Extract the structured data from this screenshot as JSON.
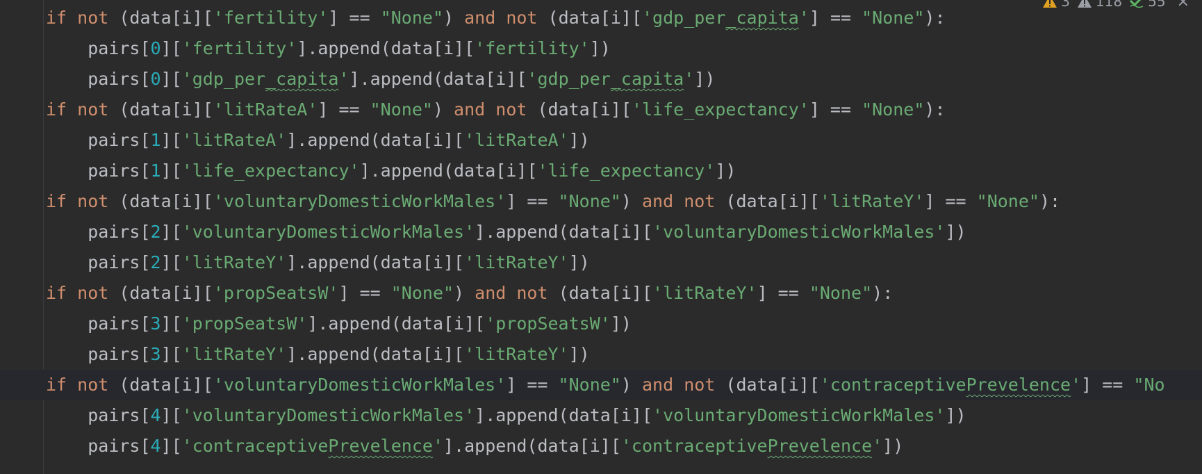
{
  "inspections": {
    "errors": "3",
    "warnings": "118",
    "weak_warnings": "55",
    "close_glyph": "×",
    "colors": {
      "error": "#e0a021",
      "warning": "#9aa0a6",
      "ok": "#5fb865"
    }
  },
  "intention_icon": "lightbulb-icon",
  "current_line_index": 12,
  "lines": [
    {
      "indent": 0,
      "tokens": [
        {
          "t": "if",
          "c": "kw"
        },
        {
          "t": " "
        },
        {
          "t": "not",
          "c": "kw"
        },
        {
          "t": " (data[i]["
        },
        {
          "t": "'fertility'",
          "c": "str"
        },
        {
          "t": "] == "
        },
        {
          "t": "\"None\"",
          "c": "str"
        },
        {
          "t": ") "
        },
        {
          "t": "and",
          "c": "kw"
        },
        {
          "t": " "
        },
        {
          "t": "not",
          "c": "kw"
        },
        {
          "t": " (data[i]["
        },
        {
          "t": "'gdp_per",
          "c": "str"
        },
        {
          "t": "_capita",
          "c": "str",
          "u": true
        },
        {
          "t": "'",
          "c": "str"
        },
        {
          "t": "] == "
        },
        {
          "t": "\"None\"",
          "c": "str"
        },
        {
          "t": "):"
        }
      ]
    },
    {
      "indent": 1,
      "tokens": [
        {
          "t": "pairs["
        },
        {
          "t": "0",
          "c": "num"
        },
        {
          "t": "]["
        },
        {
          "t": "'fertility'",
          "c": "str"
        },
        {
          "t": "].append(data[i]["
        },
        {
          "t": "'fertility'",
          "c": "str"
        },
        {
          "t": "])"
        }
      ]
    },
    {
      "indent": 1,
      "tokens": [
        {
          "t": "pairs["
        },
        {
          "t": "0",
          "c": "num"
        },
        {
          "t": "]["
        },
        {
          "t": "'gdp_per",
          "c": "str"
        },
        {
          "t": "_capita",
          "c": "str",
          "u": true
        },
        {
          "t": "'",
          "c": "str"
        },
        {
          "t": "].append(data[i]["
        },
        {
          "t": "'gdp_per",
          "c": "str"
        },
        {
          "t": "_capita",
          "c": "str",
          "u": true
        },
        {
          "t": "'",
          "c": "str"
        },
        {
          "t": "])"
        }
      ]
    },
    {
      "indent": 0,
      "tokens": [
        {
          "t": "if",
          "c": "kw"
        },
        {
          "t": " "
        },
        {
          "t": "not",
          "c": "kw"
        },
        {
          "t": " (data[i]["
        },
        {
          "t": "'litRateA'",
          "c": "str"
        },
        {
          "t": "] == "
        },
        {
          "t": "\"None\"",
          "c": "str"
        },
        {
          "t": ") "
        },
        {
          "t": "and",
          "c": "kw"
        },
        {
          "t": " "
        },
        {
          "t": "not",
          "c": "kw"
        },
        {
          "t": " (data[i]["
        },
        {
          "t": "'life_expectancy'",
          "c": "str"
        },
        {
          "t": "] == "
        },
        {
          "t": "\"None\"",
          "c": "str"
        },
        {
          "t": "):"
        }
      ]
    },
    {
      "indent": 1,
      "tokens": [
        {
          "t": "pairs["
        },
        {
          "t": "1",
          "c": "num"
        },
        {
          "t": "]["
        },
        {
          "t": "'litRateA'",
          "c": "str"
        },
        {
          "t": "].append(data[i]["
        },
        {
          "t": "'litRateA'",
          "c": "str"
        },
        {
          "t": "])"
        }
      ]
    },
    {
      "indent": 1,
      "tokens": [
        {
          "t": "pairs["
        },
        {
          "t": "1",
          "c": "num"
        },
        {
          "t": "]["
        },
        {
          "t": "'life_expectancy'",
          "c": "str"
        },
        {
          "t": "].append(data[i]["
        },
        {
          "t": "'life_expectancy'",
          "c": "str"
        },
        {
          "t": "])"
        }
      ]
    },
    {
      "indent": 0,
      "tokens": [
        {
          "t": "if",
          "c": "kw"
        },
        {
          "t": " "
        },
        {
          "t": "not",
          "c": "kw"
        },
        {
          "t": " (data[i]["
        },
        {
          "t": "'voluntaryDomesticWorkMales'",
          "c": "str"
        },
        {
          "t": "] == "
        },
        {
          "t": "\"None\"",
          "c": "str"
        },
        {
          "t": ") "
        },
        {
          "t": "and",
          "c": "kw"
        },
        {
          "t": " "
        },
        {
          "t": "not",
          "c": "kw"
        },
        {
          "t": " (data[i]["
        },
        {
          "t": "'litRateY'",
          "c": "str"
        },
        {
          "t": "] == "
        },
        {
          "t": "\"None\"",
          "c": "str"
        },
        {
          "t": "):"
        }
      ]
    },
    {
      "indent": 1,
      "tokens": [
        {
          "t": "pairs["
        },
        {
          "t": "2",
          "c": "num"
        },
        {
          "t": "]["
        },
        {
          "t": "'voluntaryDomesticWorkMales'",
          "c": "str"
        },
        {
          "t": "].append(data[i]["
        },
        {
          "t": "'voluntaryDomesticWorkMales'",
          "c": "str"
        },
        {
          "t": "])"
        }
      ]
    },
    {
      "indent": 1,
      "tokens": [
        {
          "t": "pairs["
        },
        {
          "t": "2",
          "c": "num"
        },
        {
          "t": "]["
        },
        {
          "t": "'litRateY'",
          "c": "str"
        },
        {
          "t": "].append(data[i]["
        },
        {
          "t": "'litRateY'",
          "c": "str"
        },
        {
          "t": "])"
        }
      ]
    },
    {
      "indent": 0,
      "tokens": [
        {
          "t": "if",
          "c": "kw"
        },
        {
          "t": " "
        },
        {
          "t": "not",
          "c": "kw"
        },
        {
          "t": " (data[i]["
        },
        {
          "t": "'propSeatsW'",
          "c": "str"
        },
        {
          "t": "] == "
        },
        {
          "t": "\"None\"",
          "c": "str"
        },
        {
          "t": ") "
        },
        {
          "t": "and",
          "c": "kw"
        },
        {
          "t": " "
        },
        {
          "t": "not",
          "c": "kw"
        },
        {
          "t": " (data[i]["
        },
        {
          "t": "'litRateY'",
          "c": "str"
        },
        {
          "t": "] == "
        },
        {
          "t": "\"None\"",
          "c": "str"
        },
        {
          "t": "):"
        }
      ]
    },
    {
      "indent": 1,
      "tokens": [
        {
          "t": "pairs["
        },
        {
          "t": "3",
          "c": "num"
        },
        {
          "t": "]["
        },
        {
          "t": "'propSeatsW'",
          "c": "str"
        },
        {
          "t": "].append(data[i]["
        },
        {
          "t": "'propSeatsW'",
          "c": "str"
        },
        {
          "t": "])"
        }
      ]
    },
    {
      "indent": 1,
      "tokens": [
        {
          "t": "pairs["
        },
        {
          "t": "3",
          "c": "num"
        },
        {
          "t": "]["
        },
        {
          "t": "'litRateY'",
          "c": "str"
        },
        {
          "t": "].append(data[i]["
        },
        {
          "t": "'litRateY'",
          "c": "str"
        },
        {
          "t": "])"
        }
      ]
    },
    {
      "indent": 0,
      "tokens": [
        {
          "t": "if",
          "c": "kw"
        },
        {
          "t": " "
        },
        {
          "t": "not",
          "c": "kw"
        },
        {
          "t": " (data[i]["
        },
        {
          "t": "'voluntaryDomesticWorkMales'",
          "c": "str"
        },
        {
          "t": "] == "
        },
        {
          "t": "\"None\"",
          "c": "str"
        },
        {
          "t": ") "
        },
        {
          "t": "and",
          "c": "kw"
        },
        {
          "t": " "
        },
        {
          "t": "not",
          "c": "kw"
        },
        {
          "t": " (data[i]["
        },
        {
          "t": "'contraceptive",
          "c": "str"
        },
        {
          "t": "Prevelence",
          "c": "str",
          "u": true
        },
        {
          "t": "'",
          "c": "str"
        },
        {
          "t": "] == "
        },
        {
          "t": "\"No",
          "c": "str"
        }
      ]
    },
    {
      "indent": 1,
      "tokens": [
        {
          "t": "pairs["
        },
        {
          "t": "4",
          "c": "num"
        },
        {
          "t": "]["
        },
        {
          "t": "'voluntaryDomesticWorkMales'",
          "c": "str"
        },
        {
          "t": "].append(data[i]["
        },
        {
          "t": "'voluntaryDomesticWorkMales'",
          "c": "str"
        },
        {
          "t": "])"
        }
      ]
    },
    {
      "indent": 1,
      "tokens": [
        {
          "t": "pairs["
        },
        {
          "t": "4",
          "c": "num"
        },
        {
          "t": "]["
        },
        {
          "t": "'contraceptive",
          "c": "str"
        },
        {
          "t": "Prevelence",
          "c": "str",
          "u": true
        },
        {
          "t": "'",
          "c": "str"
        },
        {
          "t": "].append(data[i]["
        },
        {
          "t": "'contraceptive",
          "c": "str"
        },
        {
          "t": "Prevelence",
          "c": "str",
          "u": true
        },
        {
          "t": "'",
          "c": "str"
        },
        {
          "t": "])"
        }
      ]
    }
  ]
}
